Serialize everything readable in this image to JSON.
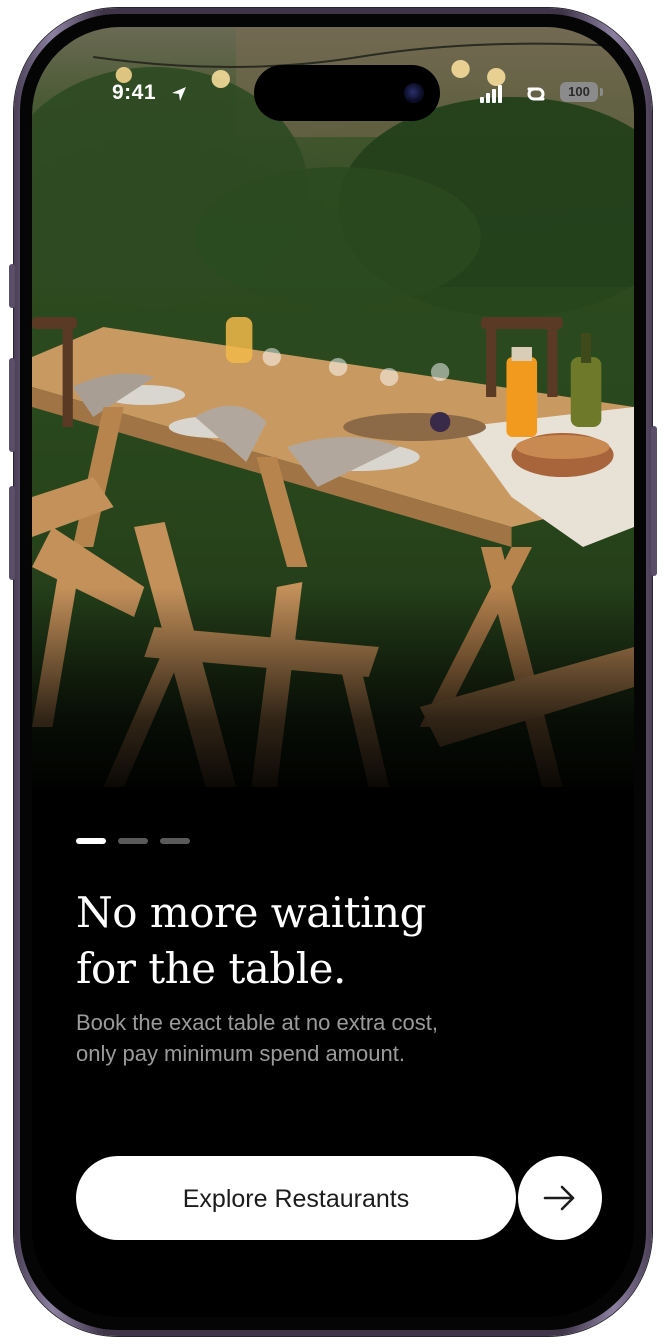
{
  "status_bar": {
    "time": "9:41",
    "battery_level": "100",
    "icons": [
      "location-arrow-icon",
      "signal-icon",
      "link-icon",
      "battery-icon"
    ]
  },
  "hero_image": {
    "description_icon": "photo"
  },
  "pagination": {
    "total_pages": 3,
    "active_page": 1
  },
  "onboarding": {
    "headline_line1": "No more waiting",
    "headline_line2": "for the table.",
    "subtitle_line1": "Book the exact table at no extra cost,",
    "subtitle_line2": "only pay minimum spend amount."
  },
  "actions": {
    "primary_label": "Explore Restaurants",
    "next_icon": "arrow-right-icon"
  },
  "colors": {
    "background": "#000000",
    "text_primary": "#ffffff",
    "text_secondary": "#9b9b9b",
    "button_bg": "#ffffff",
    "button_text": "#1c1c1c",
    "frame": "#3f3549"
  }
}
